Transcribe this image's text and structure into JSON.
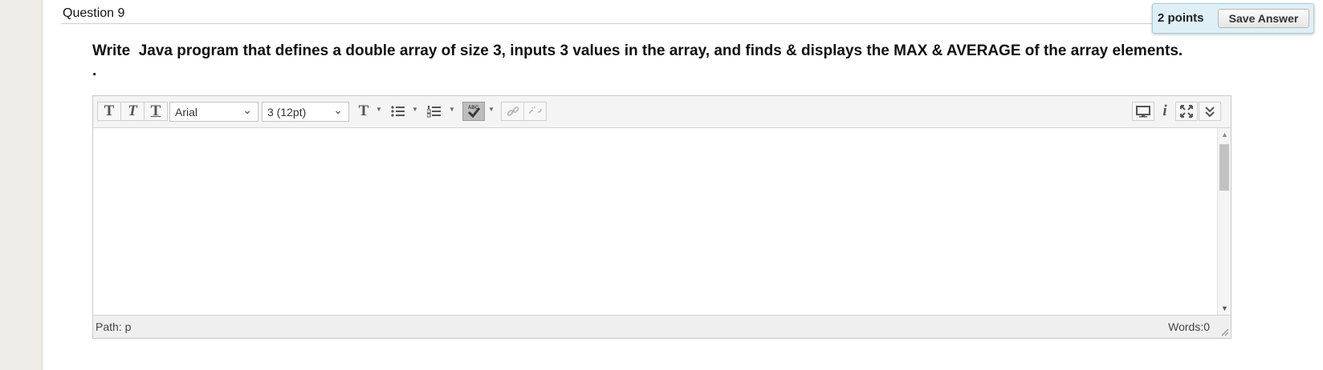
{
  "question": {
    "title": "Question 9",
    "points": "2 points",
    "save_label": "Save Answer",
    "text": "Write  Java program that defines a double array of size 3, inputs 3 values in the array, and finds & displays the MAX & AVERAGE of the array elements.",
    "trailing": "."
  },
  "editor": {
    "toolbar": {
      "bold_glyph": "T",
      "italic_glyph": "T",
      "underline_glyph": "T",
      "font_family": "Arial",
      "font_size": "3 (12pt)",
      "text_color_glyph": "T",
      "icons": [
        "bold-icon",
        "italic-icon",
        "underline-icon",
        "text-color-icon",
        "bullet-list-icon",
        "numbered-list-icon",
        "spellcheck-icon",
        "link-icon",
        "unlink-icon",
        "preview-icon",
        "info-icon",
        "fullscreen-icon",
        "expand-toolbar-icon"
      ]
    },
    "content": "",
    "status": {
      "path": "Path: p",
      "words": "Words:0"
    }
  },
  "colors": {
    "points_bg": "#dfeff6",
    "rail": "#efede8",
    "toolbar_bg": "#f4f4f4"
  }
}
